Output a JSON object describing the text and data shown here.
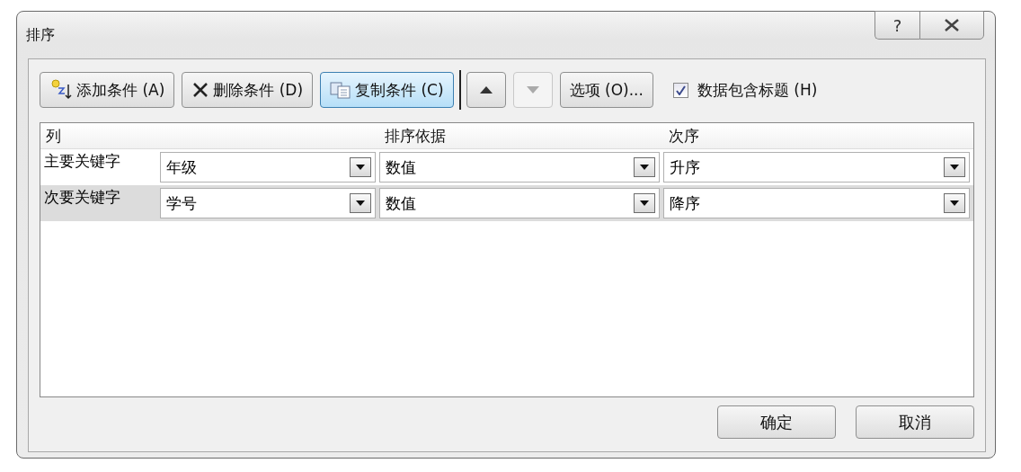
{
  "window": {
    "title": "排序",
    "help_button": "?"
  },
  "toolbar": {
    "buttons": [
      {
        "kind": "add",
        "label": "添加条件 (A)",
        "disabled": false,
        "selected": false
      },
      {
        "kind": "delete",
        "label": "删除条件 (D)",
        "disabled": false,
        "selected": false
      },
      {
        "kind": "copy",
        "label": "复制条件 (C)",
        "disabled": false,
        "selected": true
      },
      {
        "kind": "up",
        "disabled": false,
        "selected": false
      },
      {
        "kind": "down",
        "disabled": true,
        "selected": false
      },
      {
        "kind": "options",
        "label": "选项 (O)...",
        "disabled": false,
        "selected": false
      }
    ],
    "header_checkbox": {
      "label": "数据包含标题 (H)",
      "checked": true
    }
  },
  "table": {
    "columns": [
      "列",
      "排序依据",
      "次序"
    ],
    "rows": [
      {
        "key": "主要关键字",
        "column": "年级",
        "sort_on": "数值",
        "order": "升序",
        "selected": false
      },
      {
        "key": "次要关键字",
        "column": "学号",
        "sort_on": "数值",
        "order": "降序",
        "selected": true
      }
    ]
  },
  "footer": {
    "buttons": [
      "确定",
      "取消"
    ]
  }
}
